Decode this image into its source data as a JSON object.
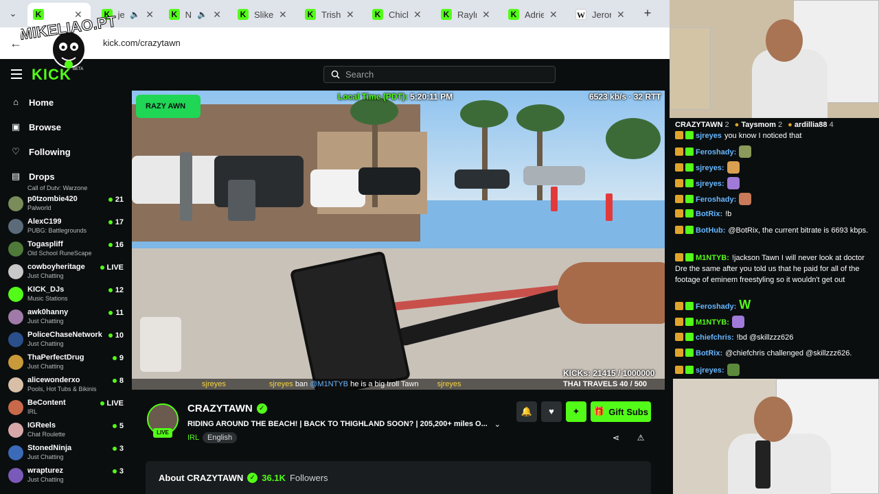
{
  "browser": {
    "tabs": [
      {
        "title": "",
        "active": true,
        "favicon": "kick"
      },
      {
        "title": "je",
        "favicon": "kick",
        "audio": true
      },
      {
        "title": "N",
        "favicon": "kick",
        "audio": true
      },
      {
        "title": "Sliker",
        "favicon": "kick"
      },
      {
        "title": "Trisha",
        "favicon": "kick"
      },
      {
        "title": "Chick",
        "favicon": "kick"
      },
      {
        "title": "Rayln",
        "favicon": "kick"
      },
      {
        "title": "Adrie",
        "favicon": "kick"
      },
      {
        "title": "Jeron",
        "favicon": "wiki"
      }
    ],
    "url": "kick.com/crazytawn",
    "new_tab_glyph": "+",
    "back_glyph": "←"
  },
  "watermark": {
    "text": "MIKELIAO.PT"
  },
  "header": {
    "logo": "KICK",
    "beta": "BETA",
    "search_placeholder": "Search"
  },
  "sidebar": {
    "nav": [
      {
        "label": "Home",
        "icon": "home-icon",
        "glyph": "⌂"
      },
      {
        "label": "Browse",
        "icon": "browse-icon",
        "glyph": "▣"
      },
      {
        "label": "Following",
        "icon": "heart-icon",
        "glyph": "♡"
      },
      {
        "label": "Drops",
        "icon": "drops-icon",
        "glyph": "▤"
      }
    ],
    "cut_label": "Call of Duty: Warzone",
    "channels": [
      {
        "name": "p0tzombie420",
        "category": "Palworld",
        "viewers": "21",
        "color": "#7a8c5a"
      },
      {
        "name": "AlexC199",
        "category": "PUBG: Battlegrounds",
        "viewers": "17",
        "color": "#5b6b7a"
      },
      {
        "name": "Togaspliff",
        "category": "Old School RuneScape",
        "viewers": "16",
        "color": "#4f7a3a"
      },
      {
        "name": "cowboyheritage",
        "category": "Just Chatting",
        "viewers": "LIVE",
        "color": "#c8c8c8"
      },
      {
        "name": "KICK_DJs",
        "category": "Music Stations",
        "viewers": "12",
        "color": "#53fc18"
      },
      {
        "name": "awk0hanny",
        "category": "Just Chatting",
        "viewers": "11",
        "color": "#a07aa8"
      },
      {
        "name": "PoliceChaseNetwork",
        "category": "Just Chatting",
        "viewers": "10",
        "color": "#2a4f8a"
      },
      {
        "name": "ThaPerfectDrug",
        "category": "Just Chatting",
        "viewers": "9",
        "color": "#c89a3a"
      },
      {
        "name": "alicewonderxo",
        "category": "Pools, Hot Tubs & Bikinis",
        "viewers": "8",
        "color": "#d8c0a8"
      },
      {
        "name": "BeContent",
        "category": "IRL",
        "viewers": "LIVE",
        "color": "#c86a4a"
      },
      {
        "name": "IGReels",
        "category": "Chat Roulette",
        "viewers": "5",
        "color": "#d8a8a8"
      },
      {
        "name": "StonedNinja",
        "category": "Just Chatting",
        "viewers": "3",
        "color": "#3a6ab8"
      },
      {
        "name": "wrapturez",
        "category": "Just Chatting",
        "viewers": "3",
        "color": "#7a5ab8"
      }
    ]
  },
  "video_overlay": {
    "logo": "RAZY   AWN",
    "local_time": "Local Time (PDT):",
    "local_time_value": "5:20:11 PM",
    "bitrate": "6523 kb/s · 32 RTT",
    "kicks": "KICKs: 21415 / 1000000",
    "travels": "THAI TRAVELS 40 / 500",
    "ticker_user1": "sjreyes",
    "ticker_user2": "sjreyes",
    "ticker_text1": "ban",
    "ticker_mention": "@M1NTYB",
    "ticker_text2": "he is a big troll Tawn",
    "ticker_user3": "sjreyes"
  },
  "stream": {
    "name": "CRAZYTAWN",
    "live": "LIVE",
    "title": "RIDING AROUND THE BEACH! | BACK TO THIGHLAND SOON? | 205,200+ miles O...",
    "category": "IRL",
    "language": "English",
    "gift_label": "Gift Subs",
    "about_label": "About CRAZYTAWN",
    "followers_count": "36.1K",
    "followers_label": "Followers"
  },
  "chat": {
    "top_gifters": [
      {
        "name": "CRAZYTAWN",
        "count": "2"
      },
      {
        "name": "Taysmom",
        "count": "2"
      },
      {
        "name": "ardillia88",
        "count": "4"
      }
    ],
    "messages": [
      {
        "user": "sjreyes",
        "text": "you know I noticed that",
        "color": "blue"
      },
      {
        "user": "Feroshady:",
        "text": "",
        "color": "blue",
        "emote": true
      },
      {
        "user": "sjreyes:",
        "text": "",
        "color": "blue",
        "emote": true
      },
      {
        "user": "sjreyes:",
        "text": "",
        "color": "blue",
        "emote": true
      },
      {
        "user": "Feroshady:",
        "text": "",
        "color": "blue",
        "emote": true
      },
      {
        "user": "BotRix:",
        "text": "!b",
        "color": "blue"
      },
      {
        "user": "BotHub:",
        "text": "@BotRix, the current bitrate is 6693 kbps.",
        "color": "blue"
      },
      {
        "user": "M1NTYB:",
        "text": "!jackson Tawn I will never look at doctor Dre the same after you told us that he paid for all of the footage of eminem freestyling so it wouldn't get out",
        "color": "green"
      },
      {
        "user": "Feroshady:",
        "text": "W",
        "color": "blue"
      },
      {
        "user": "M1NTYB:",
        "text": "",
        "color": "green",
        "emote": true
      },
      {
        "user": "chiefchris:",
        "text": "!bd @skillzzz626",
        "color": "blue"
      },
      {
        "user": "BotRix:",
        "text": "@chiefchris challenged @skillzzz626.",
        "color": "blue"
      },
      {
        "user": "sjreyes:",
        "text": "",
        "color": "blue",
        "emote": true
      }
    ]
  }
}
